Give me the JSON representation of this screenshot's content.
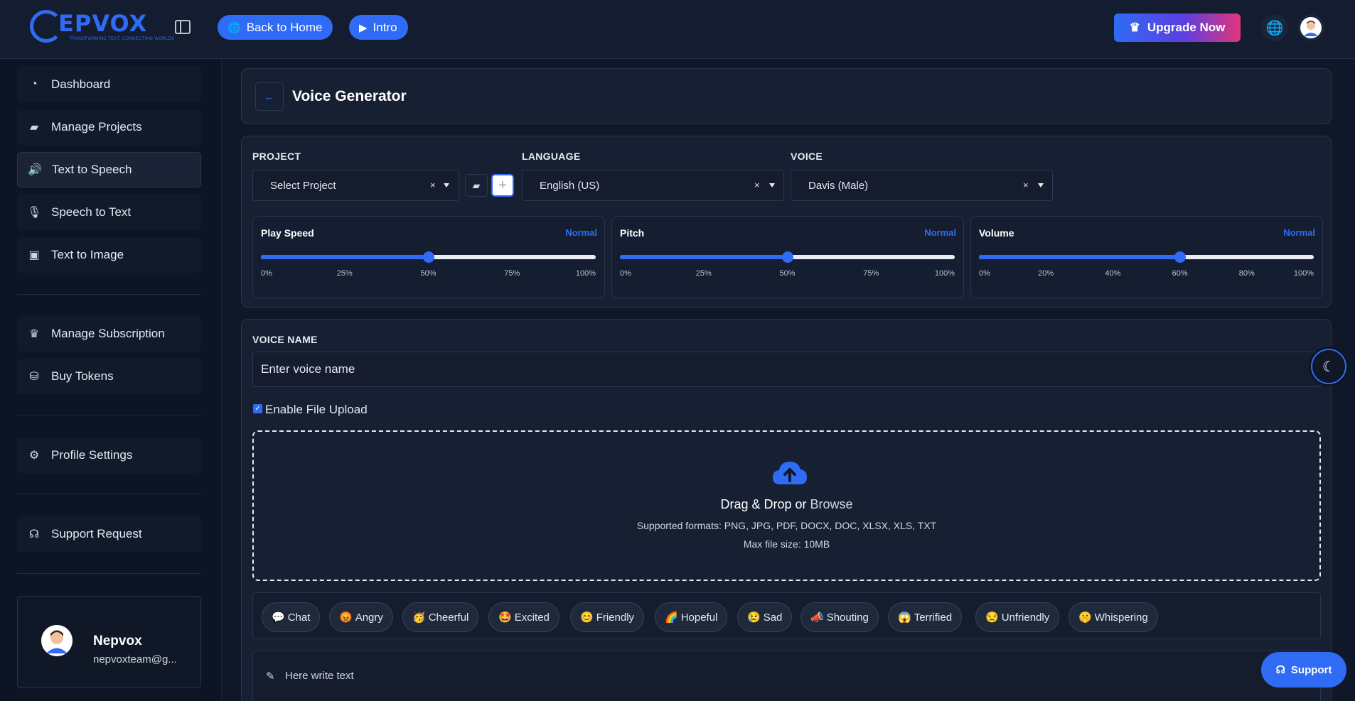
{
  "header": {
    "logo_text": "EPVOX",
    "logo_tagline": "TRANSFORMING TEXT, CONNECTING WORLDS",
    "back_home_label": "Back to Home",
    "intro_label": "Intro",
    "upgrade_label": "Upgrade Now"
  },
  "sidebar": {
    "items": [
      {
        "label": "Dashboard",
        "icon": "gauge-icon"
      },
      {
        "label": "Manage Projects",
        "icon": "folder-open-icon"
      },
      {
        "label": "Text to Speech",
        "icon": "speaker-icon"
      },
      {
        "label": "Speech to Text",
        "icon": "microphone-icon"
      },
      {
        "label": "Text to Image",
        "icon": "images-icon"
      },
      {
        "label": "Manage Subscription",
        "icon": "crown-icon"
      },
      {
        "label": "Buy Tokens",
        "icon": "coins-icon"
      },
      {
        "label": "Profile Settings",
        "icon": "user-gear-icon"
      },
      {
        "label": "Support Request",
        "icon": "headset-icon"
      }
    ],
    "active_item": "Text to Speech",
    "user": {
      "name": "Nepvox",
      "email": "nepvoxteam@g..."
    }
  },
  "page": {
    "title": "Voice Generator"
  },
  "settings": {
    "project": {
      "label": "PROJECT",
      "value": "Select Project"
    },
    "language": {
      "label": "LANGUAGE",
      "value": "English (US)"
    },
    "voice": {
      "label": "VOICE",
      "value": "Davis (Male)"
    },
    "sliders": [
      {
        "title": "Play Speed",
        "value_label": "Normal",
        "value": 0.5,
        "ticks": [
          "0%",
          "25%",
          "50%",
          "75%",
          "100%"
        ]
      },
      {
        "title": "Pitch",
        "value_label": "Normal",
        "value": 0.5,
        "ticks": [
          "0%",
          "25%",
          "50%",
          "75%",
          "100%"
        ]
      },
      {
        "title": "Volume",
        "value_label": "Normal",
        "value": 0.6,
        "ticks": [
          "0%",
          "20%",
          "40%",
          "60%",
          "80%",
          "100%"
        ]
      }
    ]
  },
  "form": {
    "voice_name_label": "VOICE NAME",
    "voice_name_placeholder": "Enter voice name",
    "enable_upload_label": "Enable File Upload",
    "enable_upload_checked": true,
    "dropzone": {
      "title_prefix": "Drag & Drop or ",
      "browse": "Browse",
      "formats": "Supported formats: PNG, JPG, PDF, DOCX, DOC, XLSX, XLS, TXT",
      "max_size": "Max file size: 10MB"
    },
    "emotions": [
      {
        "emoji": "💬",
        "label": "Chat"
      },
      {
        "emoji": "😡",
        "label": "Angry"
      },
      {
        "emoji": "🥳",
        "label": "Cheerful"
      },
      {
        "emoji": "🤩",
        "label": "Excited"
      },
      {
        "emoji": "😊",
        "label": "Friendly"
      },
      {
        "emoji": "🌈",
        "label": "Hopeful"
      },
      {
        "emoji": "😢",
        "label": "Sad"
      },
      {
        "emoji": "📣",
        "label": "Shouting"
      },
      {
        "emoji": "😱",
        "label": "Terrified"
      },
      {
        "emoji": "😒",
        "label": "Unfriendly"
      },
      {
        "emoji": "🤫",
        "label": "Whispering"
      }
    ],
    "text_placeholder": "Here write text"
  },
  "support_label": "Support",
  "colors": {
    "accent": "#2f6bf5",
    "background": "#0f1729",
    "panel": "#172033"
  }
}
